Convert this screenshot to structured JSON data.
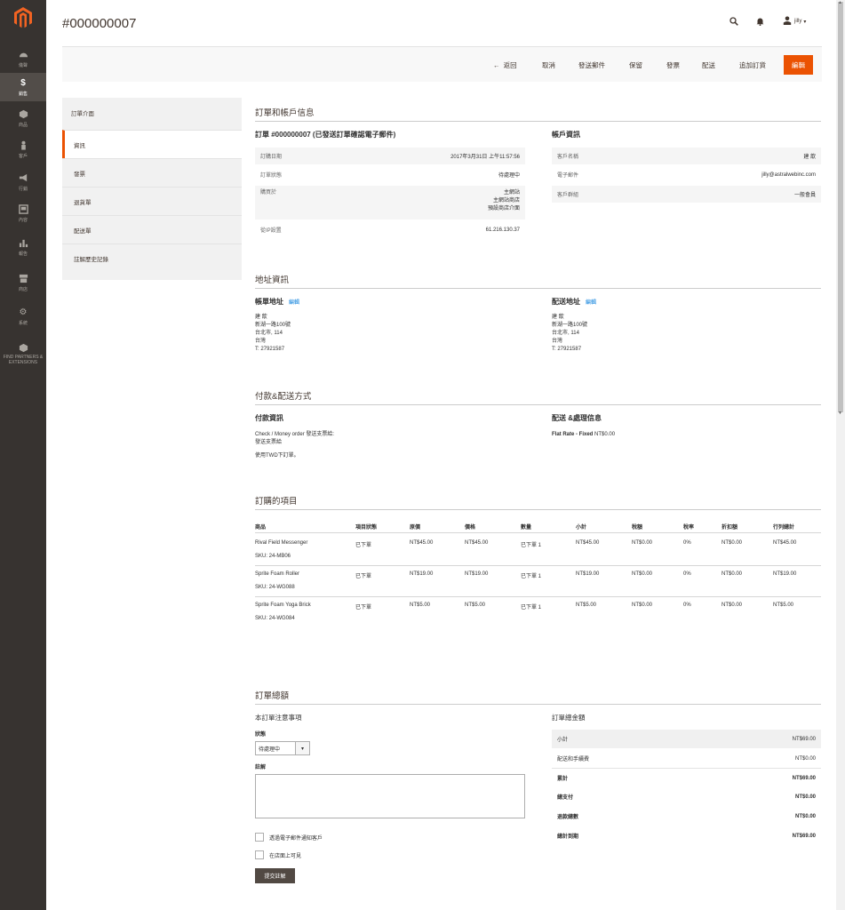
{
  "nav": {
    "items": [
      {
        "label": "儀聲",
        "icon": "dashboard-icon"
      },
      {
        "label": "銷售",
        "icon": "dollar-icon"
      },
      {
        "label": "商品",
        "icon": "cube-icon"
      },
      {
        "label": "客戶",
        "icon": "person-icon"
      },
      {
        "label": "行銷",
        "icon": "megaphone-icon"
      },
      {
        "label": "內容",
        "icon": "content-icon"
      },
      {
        "label": "報告",
        "icon": "bar-chart-icon"
      },
      {
        "label": "商店",
        "icon": "store-icon"
      },
      {
        "label": "系統",
        "icon": "gear-icon"
      }
    ],
    "partners": "FIND PARTNERS & EXTENSIONS"
  },
  "header": {
    "title": "#000000007",
    "user": "jilly"
  },
  "actions": {
    "back": "返回",
    "cancel": "取消",
    "send_email": "發送郵件",
    "hold": "保留",
    "invoice": "發票",
    "ship": "配送",
    "reorder": "追加訂貨",
    "edit": "編輯"
  },
  "tabs": {
    "title": "訂單介面",
    "items": [
      "資訊",
      "發票",
      "退貨單",
      "配送單",
      "註解歷史記錄"
    ]
  },
  "order_account": {
    "section_title": "訂單和帳戶信息",
    "order_heading": "訂單 #000000007 (已發送訂單確認電子郵件)",
    "rows": [
      {
        "k": "訂購日期",
        "v": "2017年3月31日 上午11:57:56"
      },
      {
        "k": "訂單狀態",
        "v": "待處理中"
      },
      {
        "k": "購買於",
        "v1": "主網站",
        "v2": "主網站商店",
        "v3": "預設商店介面"
      },
      {
        "k": "從IP設置",
        "v": "61.216.130.37"
      }
    ],
    "account_heading": "帳戶資訊",
    "account_rows": [
      {
        "k": "客戶名稱",
        "v": "建 歆"
      },
      {
        "k": "電子郵件",
        "v": "jilly@astralwebinc.com"
      },
      {
        "k": "客戶群組",
        "v": "一般會員"
      }
    ]
  },
  "address": {
    "section_title": "地址資訊",
    "billing_heading": "帳單地址",
    "shipping_heading": "配送地址",
    "edit": "編輯",
    "lines": [
      "建 歆",
      "新湖一路100號",
      "台北市, 114",
      "台灣",
      "T: 27921587"
    ]
  },
  "payment": {
    "section_title": "付款&配送方式",
    "payment_heading": "付款資訊",
    "payment_line1": "Check / Money order 發送支票給:",
    "payment_line2": "發送支票給",
    "payment_line3": "使用TWD下訂單。",
    "shipping_heading": "配送 &處理信息",
    "shipping_method": "Flat Rate - Fixed",
    "shipping_price": "NT$0.00"
  },
  "items": {
    "section_title": "訂購的項目",
    "headers": [
      "商品",
      "項目狀態",
      "原價",
      "價格",
      "數量",
      "小計",
      "稅額",
      "稅率",
      "折扣額",
      "行列總計"
    ],
    "rows": [
      {
        "name": "Rival Field Messenger",
        "sku": "SKU: 24-MB06",
        "status": "已下單",
        "orig": "NT$45.00",
        "price": "NT$45.00",
        "qty": "已下單 1",
        "subtotal": "NT$45.00",
        "tax": "NT$0.00",
        "rate": "0%",
        "discount": "NT$0.00",
        "total": "NT$45.00"
      },
      {
        "name": "Sprite Foam Roller",
        "sku": "SKU: 24-WG088",
        "status": "已下單",
        "orig": "NT$19.00",
        "price": "NT$19.00",
        "qty": "已下單 1",
        "subtotal": "NT$19.00",
        "tax": "NT$0.00",
        "rate": "0%",
        "discount": "NT$0.00",
        "total": "NT$19.00"
      },
      {
        "name": "Sprite Foam Yoga Brick",
        "sku": "SKU: 24-WG084",
        "status": "已下單",
        "orig": "NT$5.00",
        "price": "NT$5.00",
        "qty": "已下單 1",
        "subtotal": "NT$5.00",
        "tax": "NT$0.00",
        "rate": "0%",
        "discount": "NT$0.00",
        "total": "NT$5.00"
      }
    ]
  },
  "totals": {
    "section_title": "訂單總額",
    "notes_heading": "本訂單注意事項",
    "status_label": "狀態",
    "status_value": "待處理中",
    "comment_label": "註解",
    "notify_label": "透過電子郵件通知客戶",
    "visible_label": "在店面上可見",
    "submit": "提交註解",
    "totals_heading": "訂單總金額",
    "rows": [
      {
        "k": "小計",
        "v": "NT$69.00"
      },
      {
        "k": "配送和手續費",
        "v": "NT$0.00"
      },
      {
        "k": "累計",
        "v": "NT$69.00"
      },
      {
        "k": "總支付",
        "v": "NT$0.00"
      },
      {
        "k": "退款總數",
        "v": "NT$0.00"
      },
      {
        "k": "總計到期",
        "v": "NT$69.00"
      }
    ]
  },
  "colors": {
    "accent": "#eb5202",
    "nav_bg": "#373330",
    "link": "#007bdb"
  }
}
